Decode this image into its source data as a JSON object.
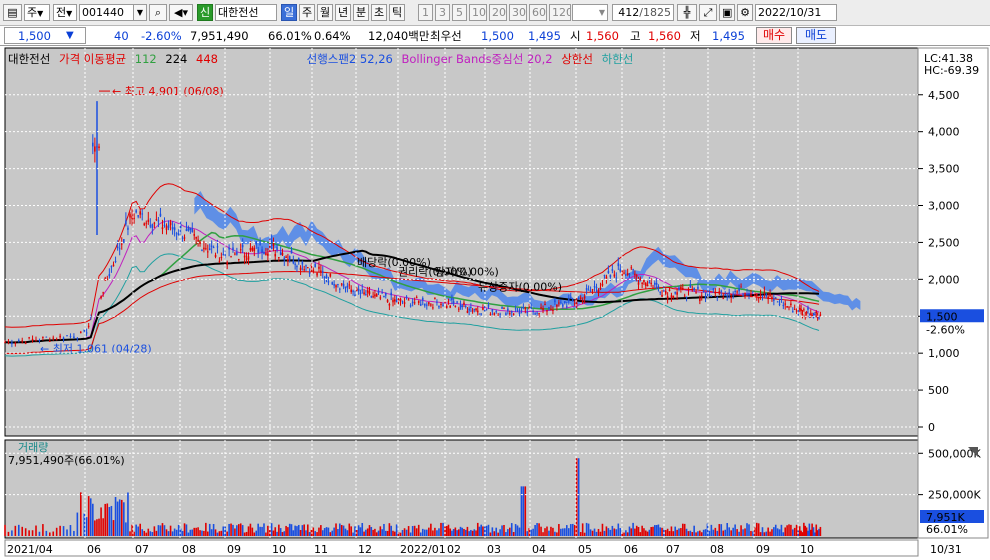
{
  "toolbar": {
    "market_label": "주",
    "type_label": "전",
    "code": "001440",
    "credit_badge": "신",
    "stock_name": "대한전선",
    "period_tabs": [
      "일",
      "주",
      "월",
      "년",
      "분",
      "초",
      "틱"
    ],
    "active_period": "일",
    "intervals": [
      "1",
      "3",
      "5",
      "10",
      "20",
      "30",
      "60",
      "120"
    ],
    "count_display": "412",
    "count_total": "/1825",
    "date_value": "2022/10/31"
  },
  "quote": {
    "price": "1,500",
    "change": "40",
    "change_pct": "-2.60%",
    "volume": "7,951,490",
    "volume_ratio": "66.01%",
    "turnover": "0.64%",
    "amount": "12,040백만",
    "best_ask_label": "최우선",
    "best_ask": "1,500",
    "best_bid": "1,495",
    "open_label": "시",
    "open": "1,560",
    "high_label": "고",
    "high": "1,560",
    "low_label": "저",
    "low": "1,495",
    "buy_label": "매수",
    "sell_label": "매도"
  },
  "legend": {
    "name": "대한전선",
    "price_ma_label": "가격 이동평균",
    "ma1": "112",
    "ma2": "224",
    "ma3": "448",
    "ichimoku": "선행스팬2 52,26",
    "bollinger": "Bollinger Bands중심선 20,2",
    "upper": "상한선",
    "lower": "하한선"
  },
  "corner": {
    "lc": "LC:41.38",
    "hc": "HC:-69.39"
  },
  "colors": {
    "up": "#e00000",
    "down": "#1a4fe0",
    "cloud": "#3c7cf0",
    "cloud_light": "#a8d8ff",
    "ma112": "#30a040",
    "ma224": "#000000",
    "ma448": "#e00000",
    "bollinger_mid": "#c020c0",
    "bollinger_upper": "#e00000",
    "bollinger_lower": "#20a0a0"
  },
  "chart_data": {
    "type": "candlestick",
    "price_ticks": [
      "4,500",
      "4,000",
      "3,500",
      "3,000",
      "2,500",
      "2,000",
      "1,500",
      "1,000",
      "500",
      "0"
    ],
    "ylim": [
      0,
      4700
    ],
    "x_labels": [
      "2021/04",
      "06",
      "07",
      "08",
      "09",
      "10",
      "11",
      "12",
      "2022/01",
      "02",
      "03",
      "04",
      "05",
      "06",
      "07",
      "08",
      "09",
      "10",
      "10/31"
    ],
    "price_series": [
      {
        "month": "2021/04",
        "value": 1150
      },
      {
        "month": "05",
        "value": 1250
      },
      {
        "month": "06",
        "value": 2900
      },
      {
        "month": "07",
        "value": 2650
      },
      {
        "month": "08",
        "value": 2300
      },
      {
        "month": "09",
        "value": 2450
      },
      {
        "month": "10",
        "value": 2150
      },
      {
        "month": "11",
        "value": 1820
      },
      {
        "month": "12",
        "value": 1700
      },
      {
        "month": "2022/01",
        "value": 1680
      },
      {
        "month": "02",
        "value": 1580
      },
      {
        "month": "03",
        "value": 1560
      },
      {
        "month": "04",
        "value": 1700
      },
      {
        "month": "05",
        "value": 2150
      },
      {
        "month": "06",
        "value": 1850
      },
      {
        "month": "07",
        "value": 1800
      },
      {
        "month": "08",
        "value": 1850
      },
      {
        "month": "09",
        "value": 1580
      },
      {
        "month": "10",
        "value": 1500
      }
    ],
    "high_annotation": "최고 4,901 (06/08)",
    "low_annotation": "최저 1,061 (04/28)",
    "event_annotations": [
      "배당락(0.00%)",
      "권리락(0.00%)",
      "감자(0.00%)",
      "유상증자(0.00%)"
    ],
    "current_price_label": "1,500",
    "current_change_label": "-2.60%",
    "volume_panel_title": "거래량",
    "volume_panel_value": "7,951,490주(66.01%)",
    "volume_ticks": [
      "500,000K",
      "250,000K"
    ],
    "volume_current_label": "7,951K",
    "volume_ratio_label": "66.01%",
    "volume_ylim": [
      0,
      550000
    ]
  }
}
